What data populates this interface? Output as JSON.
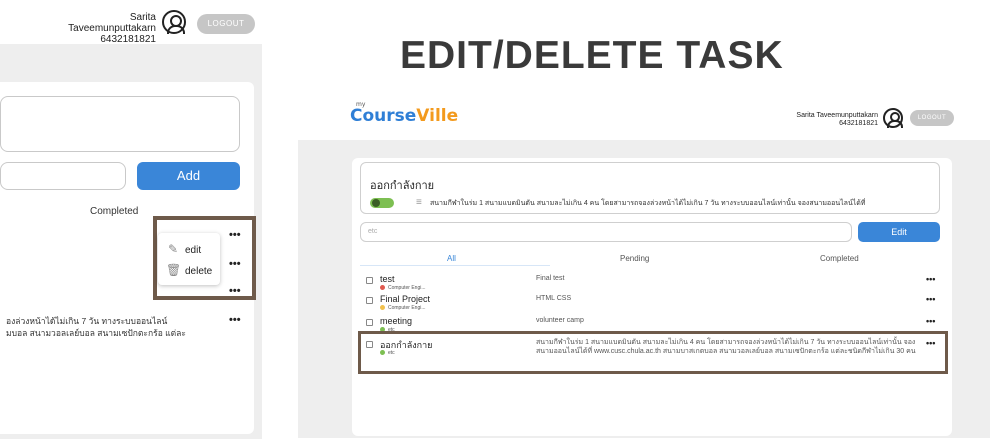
{
  "left_crop": {
    "user_name": "Sarita Taveemunputtakarn",
    "user_id": "6432181821",
    "logout_label": "LOGOUT",
    "add_label": "Add",
    "completed_tab": "Completed",
    "menu": {
      "edit_label": "edit",
      "delete_label": "delete",
      "edit_icon": "pencil-icon",
      "delete_icon": "trash-icon"
    },
    "more_label": "•••",
    "desc_line1": "องล่วงหน้าได้ไม่เกิน 7 วัน ทางระบบออนไลน์",
    "desc_line2": "มบอล สนามวอลเลย์บอล สนามเซปักตะกร้อ แต่ละ"
  },
  "title": "EDIT/DELETE TASK",
  "app": {
    "logo_my": "my",
    "logo_part1": "Course",
    "logo_part2": "Ville",
    "user_name": "Sarita Taveemunputtakarn",
    "user_id": "6432181821",
    "logout_label": "LOGOUT",
    "edit_title": "ออกกำลังกาย",
    "edit_description": "สนามกีฬาในร่ม 1 สนามแบดมินตัน สนามละไม่เกิน 4 คน โดยสามารถจองล่วงหน้าได้ไม่เกิน 7 วัน ทางระบบออนไลน์เท่านั้น จองสนามออนไลน์ได้ที่",
    "category_value": "etc",
    "edit_button": "Edit",
    "tabs": [
      "All",
      "Pending",
      "Completed"
    ],
    "tasks": [
      {
        "name": "test",
        "category": "Computer Engi...",
        "color": "#e05a4f",
        "description": "Final test"
      },
      {
        "name": "Final Project",
        "category": "Computer Engi...",
        "color": "#f2c14e",
        "description": "HTML CSS"
      },
      {
        "name": "meeting",
        "category": "etc",
        "color": "#7dbf52",
        "description": "volunteer camp"
      },
      {
        "name": "ออกกำลังกาย",
        "category": "etc",
        "color": "#7dbf52",
        "description": "สนามกีฬาในร่ม 1 สนามแบดมินตัน สนามละไม่เกิน 4 คน โดยสามารถจองล่วงหน้าได้ไม่เกิน 7 วัน ทางระบบออนไลน์เท่านั้น จองสนามออนไลน์ได้ที่ www.cusc.chula.ac.th สนามบาสเกตบอล สนามวอลเลย์บอล สนามเซปักตะกร้อ แต่ละชนิดกีฬาไม่เกิน 30 คน"
      }
    ],
    "more_label": "•••",
    "colors": {
      "accent": "#3a86d8",
      "toggle": "#7dbf52",
      "highlight_border": "#6e5a4a"
    }
  }
}
